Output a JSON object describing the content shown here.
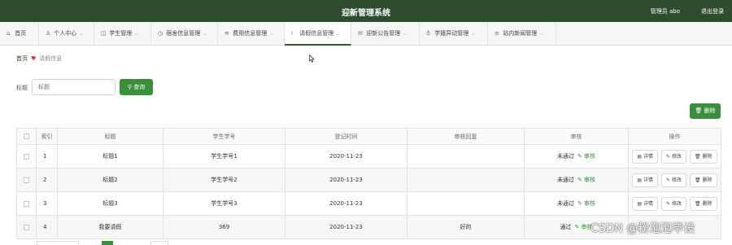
{
  "header": {
    "title": "迎新管理系统",
    "user": "管理员 abo",
    "logout": "退出登录"
  },
  "nav": [
    {
      "icon": "home-icon",
      "glyph": "⌂",
      "label": "首页",
      "has_menu": false
    },
    {
      "icon": "user-icon",
      "glyph": "♙",
      "label": "个人中心",
      "has_menu": true
    },
    {
      "icon": "student-icon",
      "glyph": "◫",
      "label": "学生管理",
      "has_menu": true
    },
    {
      "icon": "dorm-icon",
      "glyph": "◷",
      "label": "宿舍信息管理",
      "has_menu": true
    },
    {
      "icon": "fee-icon",
      "glyph": "≋",
      "label": "费用信息管理",
      "has_menu": true
    },
    {
      "icon": "mic-icon",
      "glyph": "♮",
      "label": "请假信息管理",
      "has_menu": true,
      "active": true
    },
    {
      "icon": "mail-icon",
      "glyph": "✉",
      "label": "迎新公告管理",
      "has_menu": true
    },
    {
      "icon": "bulb-icon",
      "glyph": "♁",
      "label": "学籍异动管理",
      "has_menu": true
    },
    {
      "icon": "list-icon",
      "glyph": "≡",
      "label": "站内新闻管理",
      "has_menu": true
    }
  ],
  "breadcrumb": {
    "home": "首页",
    "current": "请假信息"
  },
  "search": {
    "label": "标题",
    "placeholder": "标题",
    "button": "查询"
  },
  "toolbar": {
    "delete_label": "删除"
  },
  "table": {
    "columns": [
      "",
      "索引",
      "标题",
      "学生学号",
      "登记时间",
      "审核回复",
      "审核",
      "操作"
    ],
    "rows": [
      {
        "index": "1",
        "title": "标题1",
        "student_no": "学生学号1",
        "date": "2020-11-23",
        "reply": "",
        "status": "未通过",
        "audit_link": "审核"
      },
      {
        "index": "2",
        "title": "标题2",
        "student_no": "学生学号2",
        "date": "2020-11-23",
        "reply": "",
        "status": "未通过",
        "audit_link": "审核"
      },
      {
        "index": "3",
        "title": "标题3",
        "student_no": "学生学号3",
        "date": "2020-11-23",
        "reply": "",
        "status": "未通过",
        "audit_link": "审核"
      },
      {
        "index": "4",
        "title": "我要请假",
        "student_no": "369",
        "date": "2020-11-23",
        "reply": "好的",
        "status": "通过",
        "audit_link": "审核"
      }
    ],
    "actions": {
      "detail": "详情",
      "edit": "修改",
      "delete": "删除"
    }
  },
  "watermark": "CSDN @粉泡泡毕设"
}
